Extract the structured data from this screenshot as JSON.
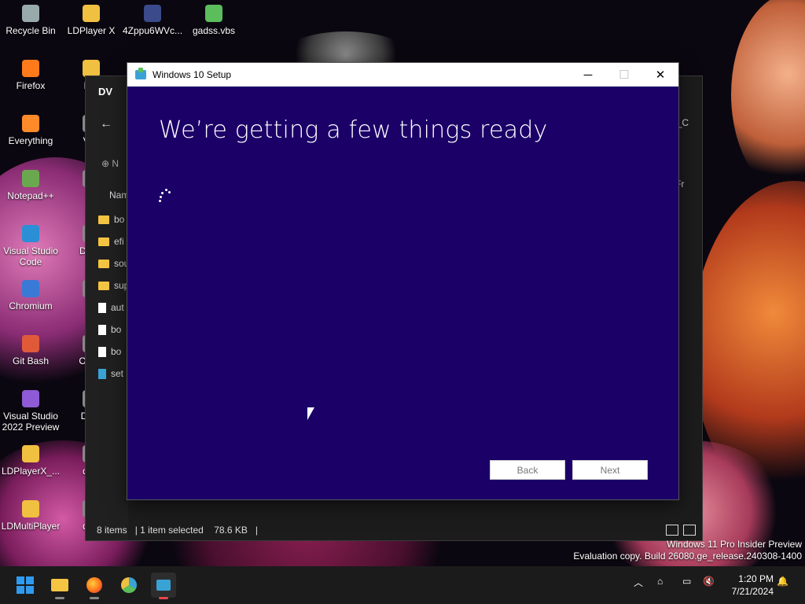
{
  "desktop": {
    "icons": [
      {
        "label": "Recycle Bin",
        "icon": "recycle-bin-icon"
      },
      {
        "label": "LDPlayer X",
        "icon": "ldplayer-icon"
      },
      {
        "label": "4Zppu6WVc...",
        "icon": "file-icon"
      },
      {
        "label": "gadss.vbs",
        "icon": "script-icon"
      },
      {
        "label": "Firefox",
        "icon": "firefox-icon"
      },
      {
        "label": "LDI",
        "icon": "ldplayer-icon"
      },
      {
        "label": "Everything",
        "icon": "everything-icon"
      },
      {
        "label": "Ven",
        "icon": "app-icon"
      },
      {
        "label": "Notepad++",
        "icon": "notepadpp-icon"
      },
      {
        "label": "D",
        "icon": "app-icon"
      },
      {
        "label": "Visual Studio Code",
        "icon": "vscode-icon"
      },
      {
        "label": "Disco",
        "icon": "app-icon"
      },
      {
        "label": "Chromium",
        "icon": "chromium-icon"
      },
      {
        "label": "S",
        "icon": "app-icon"
      },
      {
        "label": "Git Bash",
        "icon": "git-icon"
      },
      {
        "label": "Op Br",
        "icon": "app-icon"
      },
      {
        "label": "Visual Studio 2022 Preview",
        "icon": "visual-studio-icon"
      },
      {
        "label": "Do S",
        "icon": "app-icon"
      },
      {
        "label": "LDPlayerX_...",
        "icon": "ldplayer-icon"
      },
      {
        "label": "desl",
        "icon": "app-icon"
      },
      {
        "label": "LDMultiPlayer",
        "icon": "ldmultiplayer-icon"
      },
      {
        "label": "desl",
        "icon": "app-icon"
      }
    ]
  },
  "explorer": {
    "title": "DV",
    "new_label": "N",
    "right_header": ":) J_C",
    "right_tab": "a Fr",
    "col_name": "Nam",
    "files": [
      {
        "name": "bo",
        "kind": "folder"
      },
      {
        "name": "efi",
        "kind": "folder"
      },
      {
        "name": "sou",
        "kind": "folder"
      },
      {
        "name": "sup",
        "kind": "folder"
      },
      {
        "name": "aut",
        "kind": "file"
      },
      {
        "name": "bo",
        "kind": "file"
      },
      {
        "name": "bo",
        "kind": "file"
      },
      {
        "name": "set",
        "kind": "setup"
      }
    ],
    "status": {
      "items": "8 items",
      "selected": "1 item selected",
      "size": "78.6 KB"
    }
  },
  "setup": {
    "window_title": "Windows 10 Setup",
    "heading": "We’re getting a few things ready",
    "back_label": "Back",
    "next_label": "Next",
    "minimize": "─",
    "maximize": "☐",
    "close": "✕"
  },
  "watermark": {
    "line1": "Windows 11 Pro Insider Preview",
    "line2": "Evaluation copy. Build 26080.ge_release.240308-1400"
  },
  "taskbar": {
    "time": "1:20 PM",
    "date": "7/21/2024",
    "apps": [
      "start-icon",
      "file-explorer-icon",
      "firefox-icon",
      "chromium-icon",
      "windows-setup-icon"
    ],
    "tray": [
      "chevron-up-icon",
      "network-off-icon",
      "display-icon",
      "volume-mute-icon",
      "notification-bell-icon"
    ]
  }
}
